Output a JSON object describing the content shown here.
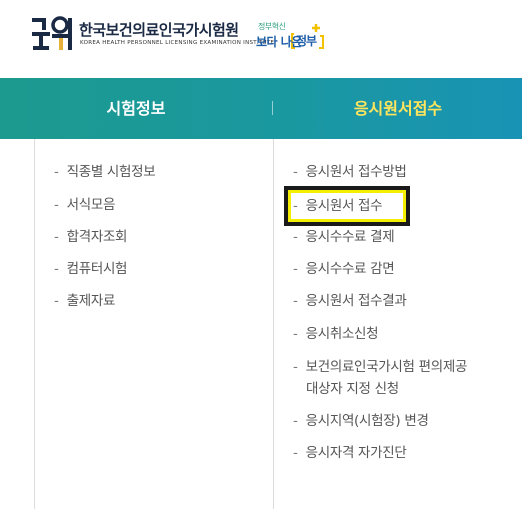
{
  "header": {
    "logo_text": "국시원",
    "org_name": "한국보건의료인국가시험원",
    "org_name_en": "KOREA HEALTH PERSONNEL LICENSING EXAMINATION INSTITUTE",
    "gov_slogan_small": "정부혁신",
    "gov_slogan_big": "보다 나은",
    "gov_name": "정부"
  },
  "nav": {
    "tabs": [
      {
        "label": "시험정보",
        "active": false
      },
      {
        "label": "응시원서접수",
        "active": true
      }
    ]
  },
  "menu_left": {
    "items": [
      {
        "label": "직종별 시험정보"
      },
      {
        "label": "서식모음"
      },
      {
        "label": "합격자조회"
      },
      {
        "label": "컴퓨터시험"
      },
      {
        "label": "출제자료"
      }
    ]
  },
  "menu_right": {
    "items": [
      {
        "label": "응시원서 접수방법"
      },
      {
        "label": "응시원서 접수",
        "highlighted": true
      },
      {
        "label": "응시수수료 결제"
      },
      {
        "label": "응시수수료 감면"
      },
      {
        "label": "응시원서 접수결과"
      },
      {
        "label": "응시취소신청"
      },
      {
        "label_line1": "보건의료인국가시험 편의제공",
        "label_line2": "대상자 지정 신청"
      },
      {
        "label": "응시지역(시험장) 변경"
      },
      {
        "label": "응시자격 자가진단"
      }
    ]
  },
  "dash": "-",
  "colors": {
    "nav_gradient_start": "#1c9a8f",
    "nav_gradient_end": "#1993b5",
    "active_tab_text": "#ffe55c",
    "highlight_border": "#f4ef00"
  }
}
